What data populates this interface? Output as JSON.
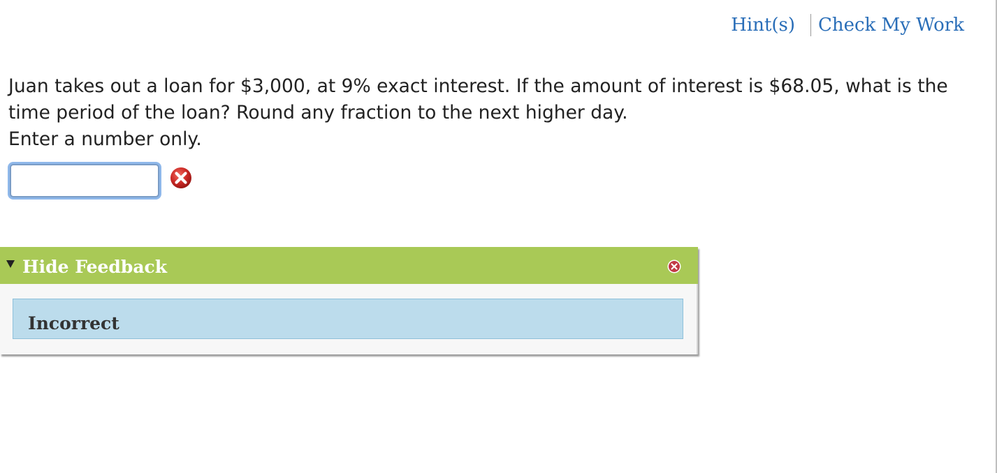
{
  "toolbar": {
    "hints_label": "Hint(s)",
    "check_work_label": "Check My Work"
  },
  "question": {
    "line1": "Juan takes out a loan for $3,000, at 9% exact interest. If the amount of interest is $68.05, what is the",
    "line2": "time period of the loan? Round any fraction to the next higher day.",
    "instruction": "Enter a number only."
  },
  "answer": {
    "value": "",
    "status": "incorrect"
  },
  "feedback": {
    "toggle_label": "Hide Feedback",
    "result": "Incorrect"
  },
  "icons": {
    "error": "error-x-circle-icon",
    "toggle": "triangle-down-icon",
    "close": "close-x-icon"
  },
  "colors": {
    "link": "#2a6eb8",
    "feedback_header": "#a9c956",
    "feedback_body": "#bcdcec",
    "error_red": "#c0282a"
  }
}
